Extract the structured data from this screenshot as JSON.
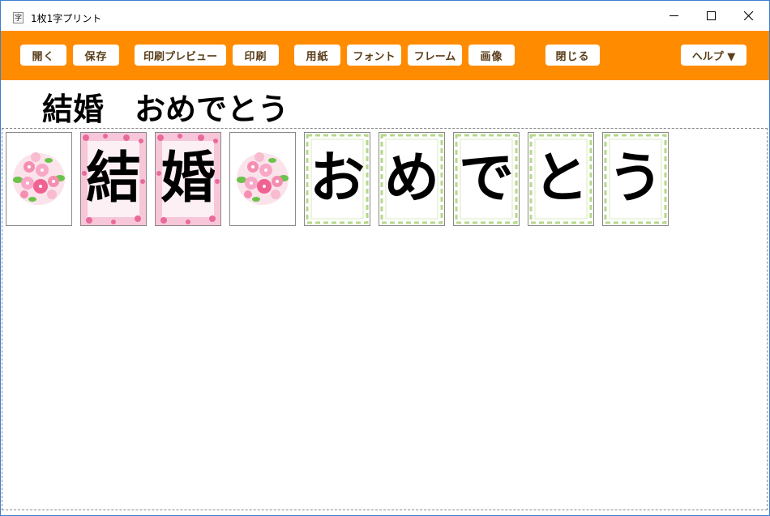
{
  "window": {
    "title": "1枚1字プリント",
    "icon_glyph": "字",
    "controls": [
      "minimize-icon",
      "maximize-icon",
      "close-icon"
    ]
  },
  "toolbar": {
    "open": "開く",
    "save": "保存",
    "print_preview": "印刷プレビュー",
    "print": "印刷",
    "paper": "用紙",
    "font": "フォント",
    "frame": "フレーム",
    "image": "画像",
    "close": "閉じる",
    "help": "ヘルプ ▼"
  },
  "message": "結婚　おめでとう",
  "cards": [
    {
      "frame": "flower-bouquet-image",
      "char": ""
    },
    {
      "frame": "sakura-frame",
      "char": "結"
    },
    {
      "frame": "sakura-frame",
      "char": "婚"
    },
    {
      "frame": "flower-bouquet-image",
      "char": ""
    },
    {
      "frame": "leaf-frame",
      "char": "お"
    },
    {
      "frame": "leaf-frame",
      "char": "め"
    },
    {
      "frame": "leaf-frame",
      "char": "で"
    },
    {
      "frame": "leaf-frame",
      "char": "と"
    },
    {
      "frame": "leaf-frame",
      "char": "う"
    }
  ],
  "colors": {
    "toolbar": "#ff8c00",
    "button_text": "#5a3e1a",
    "window_border": "#3d7fd1",
    "sakura_pink": "#f4a6c6",
    "leaf_green": "#b5d88a"
  }
}
